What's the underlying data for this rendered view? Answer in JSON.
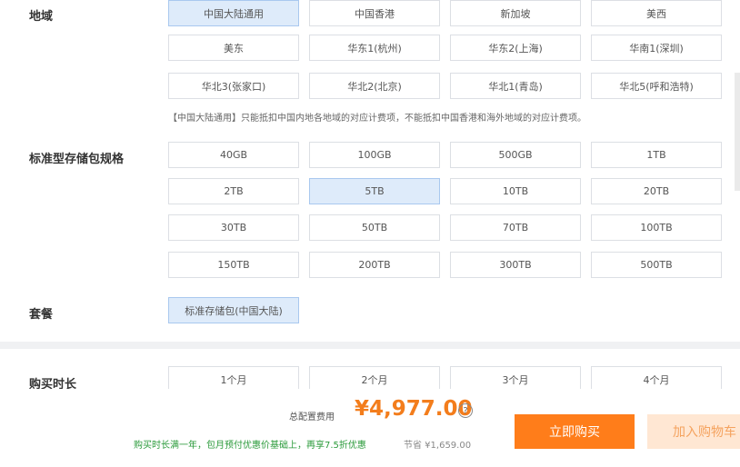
{
  "region": {
    "label": "地域",
    "options": [
      "中国大陆通用",
      "中国香港",
      "新加坡",
      "美西",
      "美东",
      "华东1(杭州)",
      "华东2(上海)",
      "华南1(深圳)",
      "华北3(张家口)",
      "华北2(北京)",
      "华北1(青岛)",
      "华北5(呼和浩特)"
    ],
    "selected": "中国大陆通用",
    "note": "【中国大陆通用】只能抵扣中国内地各地域的对应计费项，不能抵扣中国香港和海外地域的对应计费项。"
  },
  "spec": {
    "label": "标准型存储包规格",
    "options": [
      "40GB",
      "100GB",
      "500GB",
      "1TB",
      "2TB",
      "5TB",
      "10TB",
      "20TB",
      "30TB",
      "50TB",
      "70TB",
      "100TB",
      "150TB",
      "200TB",
      "300TB",
      "500TB"
    ],
    "selected": "5TB"
  },
  "package": {
    "label": "套餐",
    "options": [
      "标准存储包(中国大陆)"
    ],
    "selected": "标准存储包(中国大陆)"
  },
  "duration": {
    "label": "购买时长",
    "options": [
      "1个月",
      "2个月",
      "3个月",
      "4个月"
    ]
  },
  "footer": {
    "total_label": "总配置费用",
    "total_price": "¥4,977.00",
    "help_icon": "?",
    "promo": "购买时长满一年，包月预付优惠价基础上，再享7.5折优惠",
    "save": "节省 ¥1,659.00",
    "buy_label": "立即购买",
    "cart_label": "加入购物车"
  },
  "colors": {
    "accent": "#ff7d1a",
    "selected_bg": "#deebfa",
    "promo_green": "#2a9a3a"
  }
}
